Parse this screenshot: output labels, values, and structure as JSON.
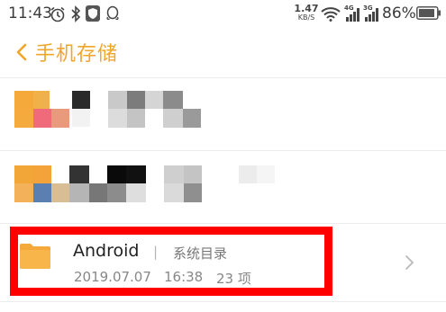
{
  "status_bar": {
    "time": "11:43",
    "net_speed_value": "1.47",
    "net_speed_unit": "KB/S",
    "signal1_label": "4G",
    "signal2_label": "3G",
    "battery_percent": "86%"
  },
  "header": {
    "title": "手机存储"
  },
  "folders": [
    {
      "name": "Android",
      "separator": "|",
      "type": "系统目录",
      "date": "2019.07.07",
      "time": "16:38",
      "count": "23 项"
    }
  ],
  "colors": {
    "accent": "#f2a52b",
    "highlight_border": "#ff0000"
  },
  "icons": [
    "alarm-icon",
    "bluetooth-icon",
    "shield-app-icon",
    "qq-icon",
    "wifi-icon",
    "signal-icon",
    "battery-icon",
    "back-icon",
    "folder-icon",
    "chevron-right-icon"
  ]
}
